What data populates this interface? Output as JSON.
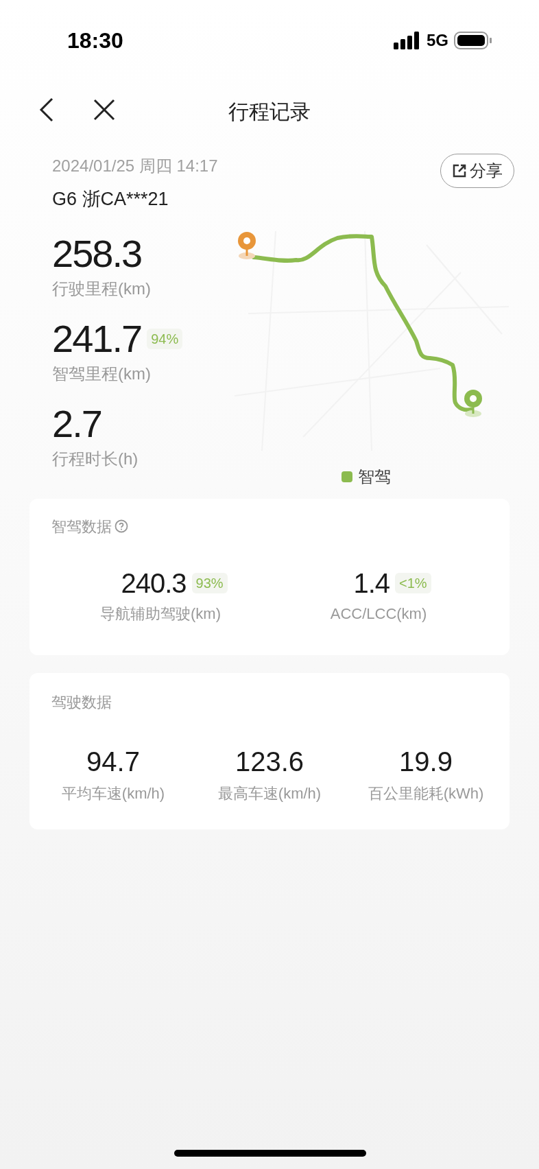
{
  "status_bar": {
    "time": "18:30",
    "network": "5G"
  },
  "header": {
    "title": "行程记录"
  },
  "trip": {
    "datetime": "2024/01/25 周四 14:17",
    "vehicle": "G6 浙CA***21",
    "share": "分享"
  },
  "stats": [
    {
      "value": "258.3",
      "label": "行驶里程(km)"
    },
    {
      "value": "241.7",
      "label": "智驾里程(km)",
      "badge": "94%"
    },
    {
      "value": "2.7",
      "label": "行程时长(h)"
    }
  ],
  "map": {
    "legend": [
      {
        "label": "智驾",
        "color": "#8cbb4f"
      }
    ]
  },
  "smart_card": {
    "title": "智驾数据",
    "items": [
      {
        "value": "240.3",
        "badge": "93%",
        "label": "导航辅助驾驶(km)"
      },
      {
        "value": "1.4",
        "badge": "<1%",
        "label": "ACC/LCC(km)"
      }
    ]
  },
  "driving_card": {
    "title": "驾驶数据",
    "items": [
      {
        "value": "94.7",
        "label": "平均车速(km/h)"
      },
      {
        "value": "123.6",
        "label": "最高车速(km/h)"
      },
      {
        "value": "19.9",
        "label": "百公里能耗(kWh)"
      }
    ]
  }
}
